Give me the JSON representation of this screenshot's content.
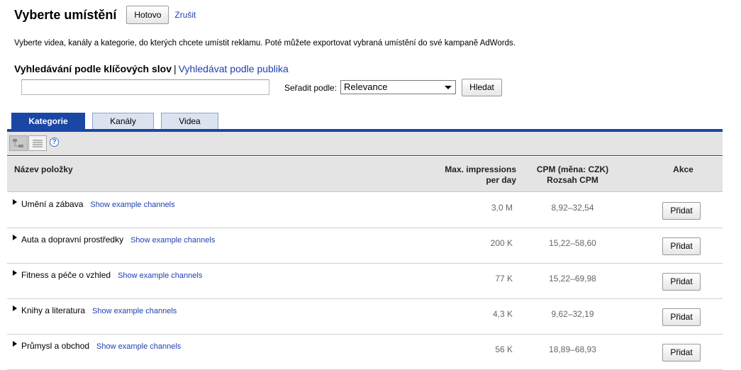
{
  "header": {
    "title": "Vyberte umístění",
    "done_label": "Hotovo",
    "cancel_label": "Zrušit"
  },
  "intro_text": "Vyberte videa, kanály a kategorie, do kterých chcete umístit reklamu. Poté můžete exportovat vybraná umístění do své kampaně AdWords.",
  "search": {
    "heading_active": "Vyhledávání podle klíčových slov",
    "separator": "|",
    "heading_link": "Vyhledávat podle publika",
    "input_value": "",
    "sort_label": "Seřadit podle:",
    "sort_selected": "Relevance",
    "search_button": "Hledat"
  },
  "tabs": [
    {
      "label": "Kategorie",
      "active": true
    },
    {
      "label": "Kanály",
      "active": false
    },
    {
      "label": "Videa",
      "active": false
    }
  ],
  "toolbar": {
    "help_glyph": "?"
  },
  "table": {
    "columns": {
      "name": "Název položky",
      "impressions_line1": "Max. impressions",
      "impressions_line2": "per day",
      "cpm_line1": "CPM (měna: CZK)",
      "cpm_line2": "Rozsah CPM",
      "action": "Akce"
    },
    "rows": [
      {
        "name": "Umění a zábava",
        "link": "Show example channels",
        "impressions": "3,0 M",
        "cpm": "8,92–32,54",
        "action": "Přidat"
      },
      {
        "name": "Auta a dopravní prostředky",
        "link": "Show example channels",
        "impressions": "200 K",
        "cpm": "15,22–58,60",
        "action": "Přidat"
      },
      {
        "name": "Fitness a péče o vzhled",
        "link": "Show example channels",
        "impressions": "77 K",
        "cpm": "15,22–69,98",
        "action": "Přidat"
      },
      {
        "name": "Knihy a literatura",
        "link": "Show example channels",
        "impressions": "4,3 K",
        "cpm": "9,62–32,19",
        "action": "Přidat"
      },
      {
        "name": "Průmysl a obchod",
        "link": "Show example channels",
        "impressions": "56 K",
        "cpm": "18,89–68,93",
        "action": "Přidat"
      }
    ]
  }
}
